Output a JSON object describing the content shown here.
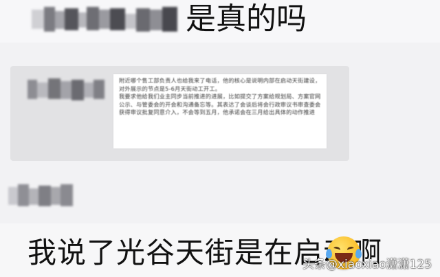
{
  "chat": {
    "top_message": {
      "sender_redacted": true,
      "text": "是真的吗"
    },
    "forwarded_card": {
      "sender_redacted": true,
      "document_text": "附近哪个售工部负责人也给我来了电话，他的核心是说明内部在启动天街建设，对外展示的节点是5-6月天街动工开工。\n我要求他给我们业主同步当前推进的进展，比如提交了方案给规划局、方案官网公示、与管委会的开会和沟通备忘等。其表达了会谈后将会行政审议书审查委会获得审议批复同意介入，不会等到五月，他承诺会在三月给出具体的动作推进"
    },
    "third_sender_redacted": true,
    "bottom_message": {
      "text": "我说了光谷天街是在启动啊",
      "emoji": "crying-laughing-emoji"
    }
  },
  "watermark": "头条@xiaoxiao潇潇125",
  "colors": {
    "background": "#f2f2f4",
    "card": "#e2e2e4",
    "paper": "#ffffff",
    "text": "#111111"
  }
}
